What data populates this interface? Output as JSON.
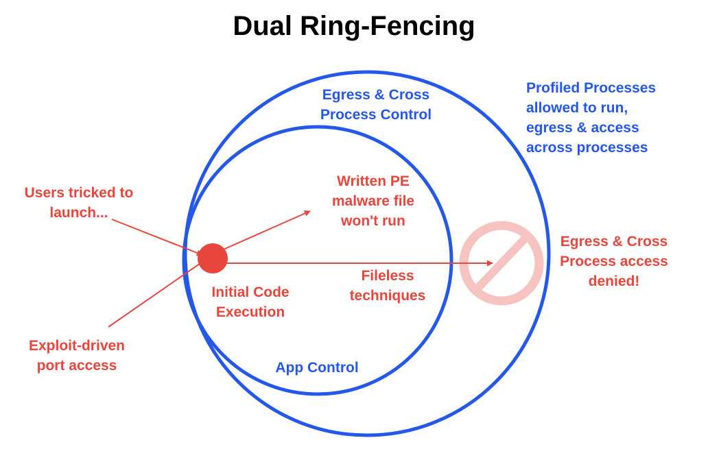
{
  "title": "Dual Ring-Fencing",
  "colors": {
    "ring": "#2458e8",
    "threat": "#e8453c",
    "deny": "#f6c3c0",
    "title": "#000000"
  },
  "icons": {
    "deny": "prohibited-icon",
    "origin": "initial-code-execution-dot"
  },
  "labels": {
    "outer_ring": "Egress & Cross\nProcess Control",
    "inner_ring": "App Control",
    "profiled": "Profiled Processes\nallowed to run,\negress & access\nacross processes",
    "users_tricked": "Users tricked to\nlaunch...",
    "exploit": "Exploit-driven\nport access",
    "written_pe": "Written PE\nmalware file\nwon't run",
    "fileless": "Fileless\ntechniques",
    "initial_exec": "Initial Code\nExecution",
    "denied": "Egress & Cross\nProcess access\ndenied!"
  }
}
